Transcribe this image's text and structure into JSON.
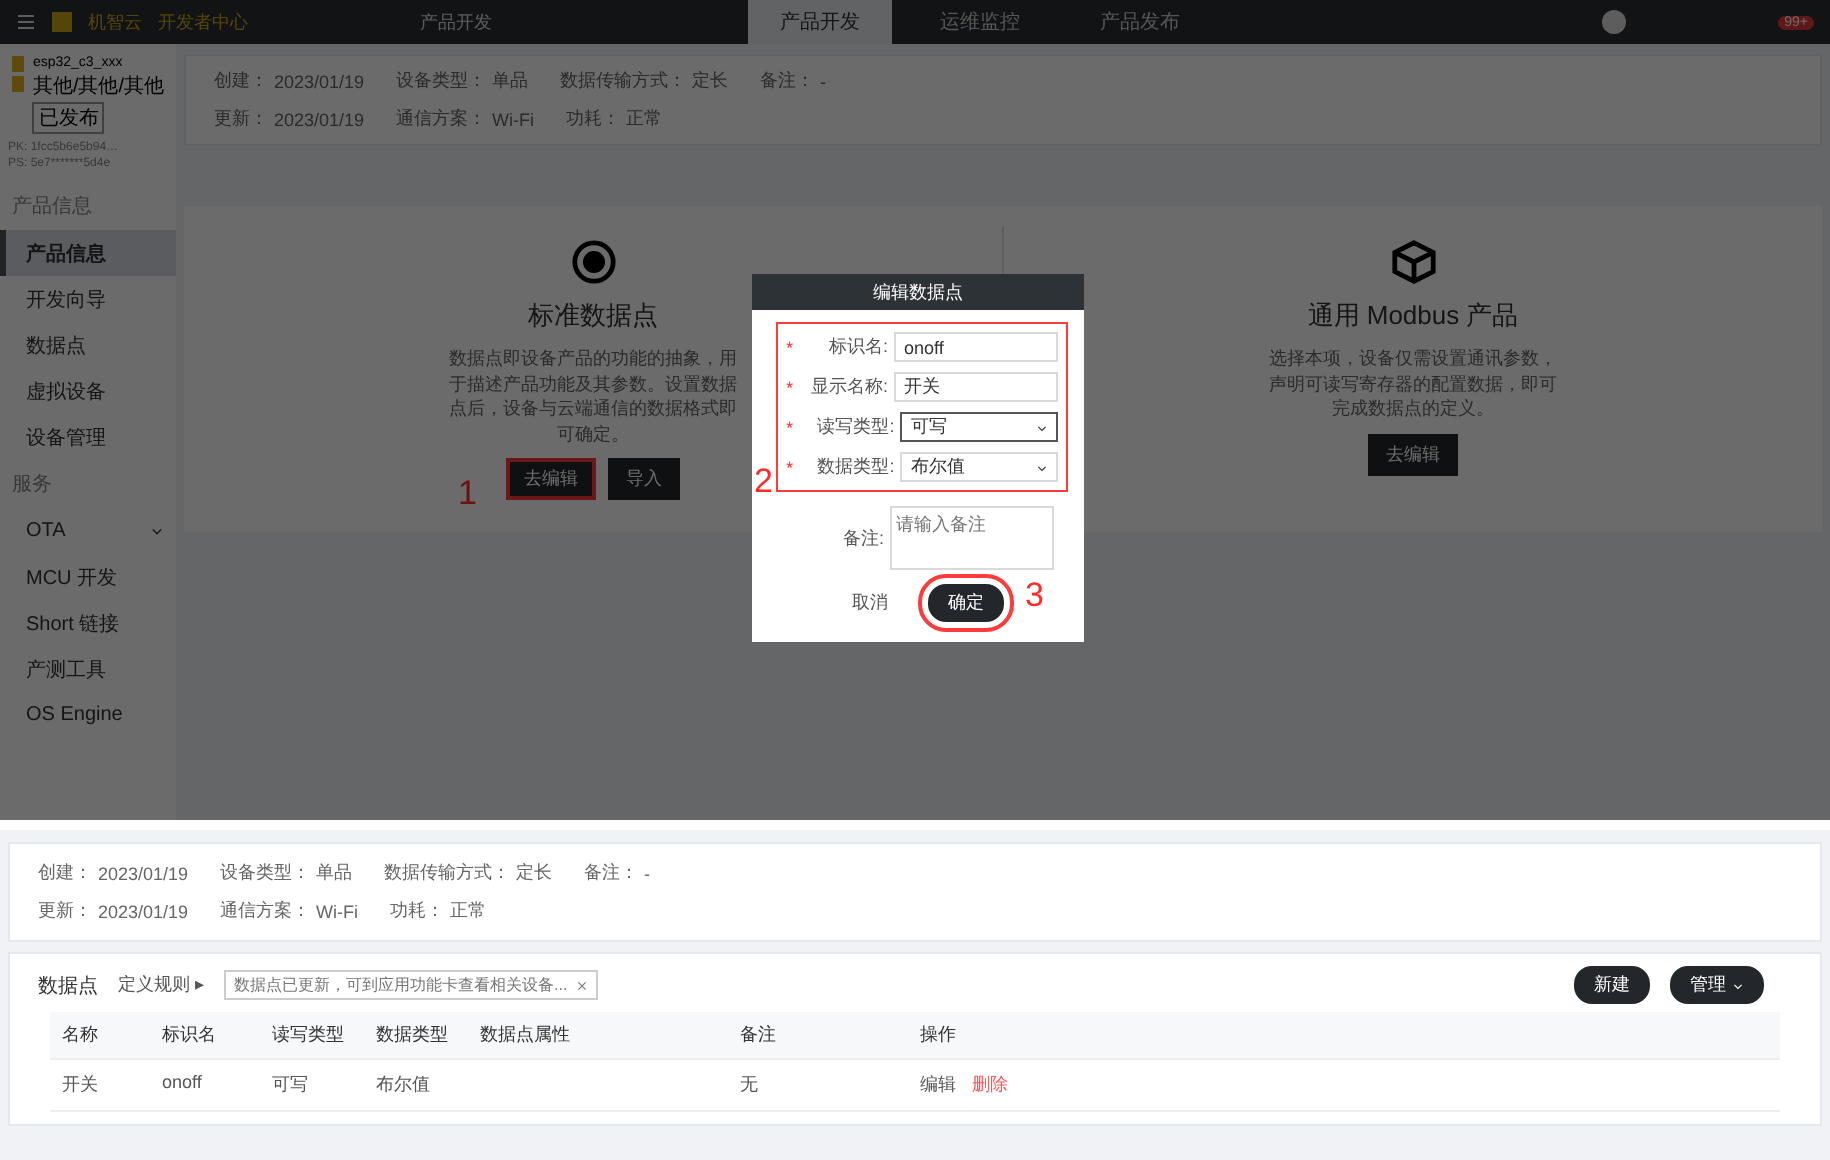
{
  "top_bar": {
    "logo": "机智云",
    "portal": "开发者中心",
    "breadcrumb": "产品开发",
    "tabs": [
      {
        "label": "产品开发",
        "selected": true
      },
      {
        "label": "运维监控",
        "selected": false
      },
      {
        "label": "产品发布",
        "selected": false
      }
    ],
    "badge": "99+"
  },
  "sidebar": {
    "product_name": "esp32_c3_xxx",
    "category": "其他/其他/其他",
    "status": "已发布",
    "pk": "PK: 1fcc5b6e5b94…",
    "ps": "PS: 5e7*******5d4e",
    "sections": [
      {
        "title": "产品信息",
        "items": [
          {
            "label": "产品信息",
            "selected": true,
            "expandable": false
          },
          {
            "label": "开发向导",
            "selected": false,
            "expandable": false
          },
          {
            "label": "数据点",
            "selected": false,
            "expandable": false
          },
          {
            "label": "虚拟设备",
            "selected": false,
            "expandable": false
          },
          {
            "label": "设备管理",
            "selected": false,
            "expandable": false
          }
        ]
      },
      {
        "title": "服务",
        "items": [
          {
            "label": "OTA",
            "selected": false,
            "expandable": true
          },
          {
            "label": "MCU 开发",
            "selected": false,
            "expandable": false
          },
          {
            "label": "Short 链接",
            "selected": false,
            "expandable": false
          },
          {
            "label": "产测工具",
            "selected": false,
            "expandable": false
          },
          {
            "label": "OS Engine",
            "selected": false,
            "expandable": false
          }
        ]
      }
    ]
  },
  "info_rows": [
    [
      {
        "label": "创建：",
        "value": "2023/01/19"
      },
      {
        "label": "设备类型：",
        "value": "单品"
      },
      {
        "label": "数据传输方式：",
        "value": "定长"
      },
      {
        "label": "备注：",
        "value": "-"
      }
    ],
    [
      {
        "label": "更新：",
        "value": "2023/01/19"
      },
      {
        "label": "通信方案：",
        "value": "Wi-Fi"
      },
      {
        "label": "功耗：",
        "value": "正常"
      }
    ]
  ],
  "cards": [
    {
      "title": "标准数据点",
      "kind": "target",
      "description": "数据点即设备产品的功能的抽象，用于描述产品功能及其参数。设置数据点后，设备与云端通信的数据格式即可确定。",
      "buttons": [
        {
          "label": "去编辑",
          "highlighted": true,
          "marker": "1"
        },
        {
          "label": "导入",
          "highlighted": false
        }
      ]
    },
    {
      "title": "通用 Modbus 产品",
      "kind": "cube",
      "description": "选择本项，设备仅需设置通讯参数，声明可读写寄存器的配置数据，即可完成数据点的定义。",
      "buttons": [
        {
          "label": "去编辑",
          "highlighted": false
        }
      ]
    }
  ],
  "dialog": {
    "title": "编辑数据点",
    "marker": "2",
    "required_mark": "*",
    "fields": [
      {
        "label": "标识名:",
        "required": true,
        "kind": "input",
        "value": "onoff"
      },
      {
        "label": "显示名称:",
        "required": true,
        "kind": "input",
        "value": "开关"
      },
      {
        "label": "读写类型:",
        "required": true,
        "kind": "select",
        "value": "可写",
        "focused": true
      },
      {
        "label": "数据类型:",
        "required": true,
        "kind": "select",
        "value": "布尔值",
        "focused": false
      }
    ],
    "remark": {
      "label": "备注:",
      "placeholder": "请输入备注"
    },
    "cancel": "取消",
    "confirm": {
      "label": "确定",
      "marker": "3"
    }
  },
  "detail": {
    "info_rows": [
      [
        {
          "label": "创建：",
          "value": "2023/01/19"
        },
        {
          "label": "设备类型：",
          "value": "单品"
        },
        {
          "label": "数据传输方式：",
          "value": "定长"
        },
        {
          "label": "备注：",
          "value": "-"
        }
      ],
      [
        {
          "label": "更新：",
          "value": "2023/01/19"
        },
        {
          "label": "通信方案：",
          "value": "Wi-Fi"
        },
        {
          "label": "功耗：",
          "value": "正常"
        }
      ]
    ],
    "section_title": "数据点",
    "rule_link": "定义规则 ▸",
    "notice": "数据点已更新，可到应用功能卡查看相关设备...",
    "new_button": "新建",
    "manage_button": "管理",
    "table": {
      "columns": [
        "名称",
        "标识名",
        "读写类型",
        "数据类型",
        "数据点属性",
        "备注",
        "操作"
      ],
      "rows": [
        {
          "cells": [
            "开关",
            "onoff",
            "可写",
            "布尔值",
            "",
            "无"
          ],
          "actions": [
            "编辑",
            "删除"
          ]
        }
      ]
    }
  }
}
